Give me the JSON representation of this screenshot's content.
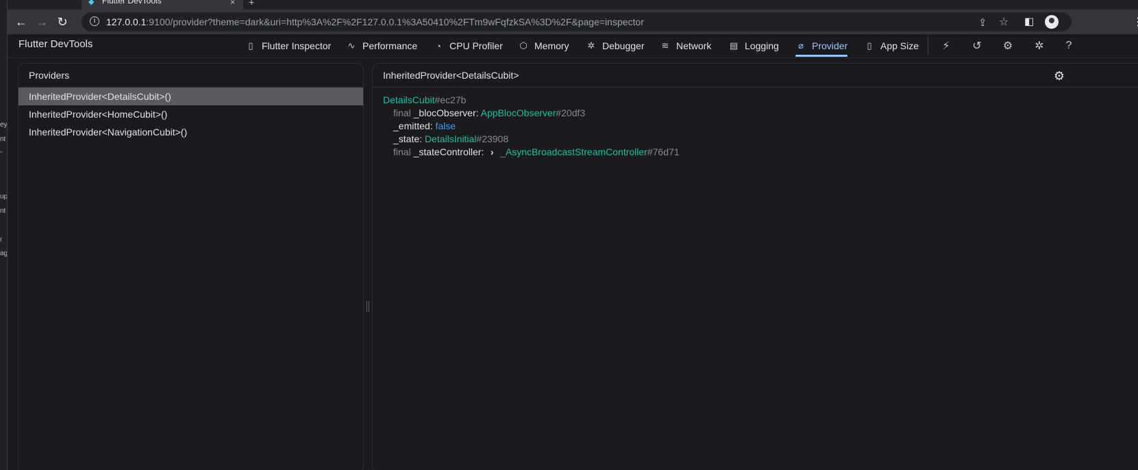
{
  "browser": {
    "tab_title": "Flutter DevTools",
    "tab_close": "×",
    "new_tab": "+",
    "url_host": "127.0.0.1",
    "url_rest": ":9100/provider?theme=dark&uri=http%3A%2F%2F127.0.0.1%3A50410%2FTm9wFqfzkSA%3D%2F&page=inspector"
  },
  "side_fragments": [
    "ey",
    "nt",
    "-",
    "up",
    "nt",
    "r",
    "ag"
  ],
  "devtools": {
    "title": "Flutter DevTools",
    "tabs": [
      {
        "label": "Flutter Inspector",
        "icon": "phone-icon",
        "active": false
      },
      {
        "label": "Performance",
        "icon": "pulse-icon",
        "active": false
      },
      {
        "label": "CPU Profiler",
        "icon": "gauge-icon",
        "active": false
      },
      {
        "label": "Memory",
        "icon": "box-icon",
        "active": false
      },
      {
        "label": "Debugger",
        "icon": "bug-icon",
        "active": false
      },
      {
        "label": "Network",
        "icon": "wifi-icon",
        "active": false
      },
      {
        "label": "Logging",
        "icon": "clipboard-icon",
        "active": false
      },
      {
        "label": "Provider",
        "icon": "paperclip-icon",
        "active": true
      },
      {
        "label": "App Size",
        "icon": "file-size-icon",
        "active": false
      }
    ],
    "accent_color": "#99c7ff"
  },
  "providers_panel": {
    "title": "Providers",
    "items": [
      {
        "label": "InheritedProvider<DetailsCubit>()",
        "selected": true
      },
      {
        "label": "InheritedProvider<HomeCubit>()",
        "selected": false
      },
      {
        "label": "InheritedProvider<NavigationCubit>()",
        "selected": false
      }
    ]
  },
  "details_panel": {
    "title": "InheritedProvider<DetailsCubit>",
    "root": {
      "type": "DetailsCubit",
      "hash": "#ec27b"
    },
    "fields": {
      "bloc_observer": {
        "modifier": "final",
        "name": "_blocObserver:",
        "type": "AppBlocObserver",
        "hash": "#20df3"
      },
      "emitted": {
        "name": "_emitted:",
        "value": "false"
      },
      "state": {
        "name": "_state:",
        "type": "DetailsInitial",
        "hash": "#23908"
      },
      "state_controller": {
        "modifier": "final",
        "name": "_stateController:",
        "expander": "›",
        "type": "_AsyncBroadcastStreamController",
        "hash": "#76d71"
      }
    },
    "type_color": "#1fbfa0",
    "bool_color": "#3d9ae8"
  }
}
